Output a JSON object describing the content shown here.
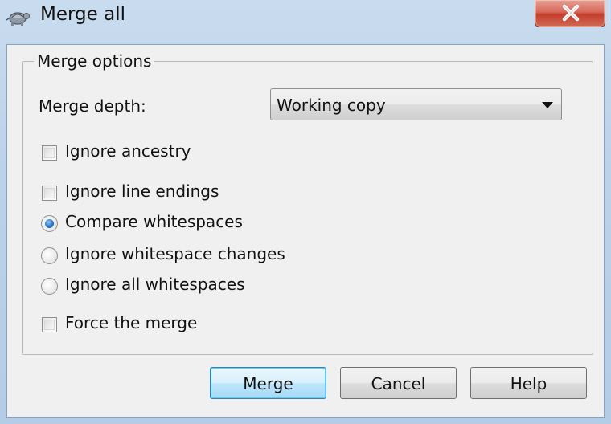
{
  "window": {
    "title": "Merge all",
    "close_glyph": "✕"
  },
  "group": {
    "legend": "Merge options"
  },
  "merge_depth": {
    "label": "Merge depth:",
    "selected": "Working copy"
  },
  "options": {
    "ignore_ancestry": {
      "label": "Ignore ancestry",
      "checked": false
    },
    "ignore_line_endings": {
      "label": "Ignore line endings",
      "checked": false
    },
    "compare_whitespaces": {
      "label": "Compare whitespaces",
      "selected": true
    },
    "ignore_whitespace_changes": {
      "label": "Ignore whitespace changes",
      "selected": false
    },
    "ignore_all_whitespaces": {
      "label": "Ignore all whitespaces",
      "selected": false
    },
    "force_merge": {
      "label": "Force the merge",
      "checked": false
    }
  },
  "buttons": {
    "merge": "Merge",
    "cancel": "Cancel",
    "help": "Help"
  },
  "icons": {
    "app": "tortoise-icon",
    "close": "close-icon",
    "dropdown": "chevron-down-icon"
  },
  "colors": {
    "titlebar": "#c9dcef",
    "close_button": "#c43e2c",
    "radio_checked": "#2a76c8",
    "default_button_border": "#3c7fb1"
  }
}
